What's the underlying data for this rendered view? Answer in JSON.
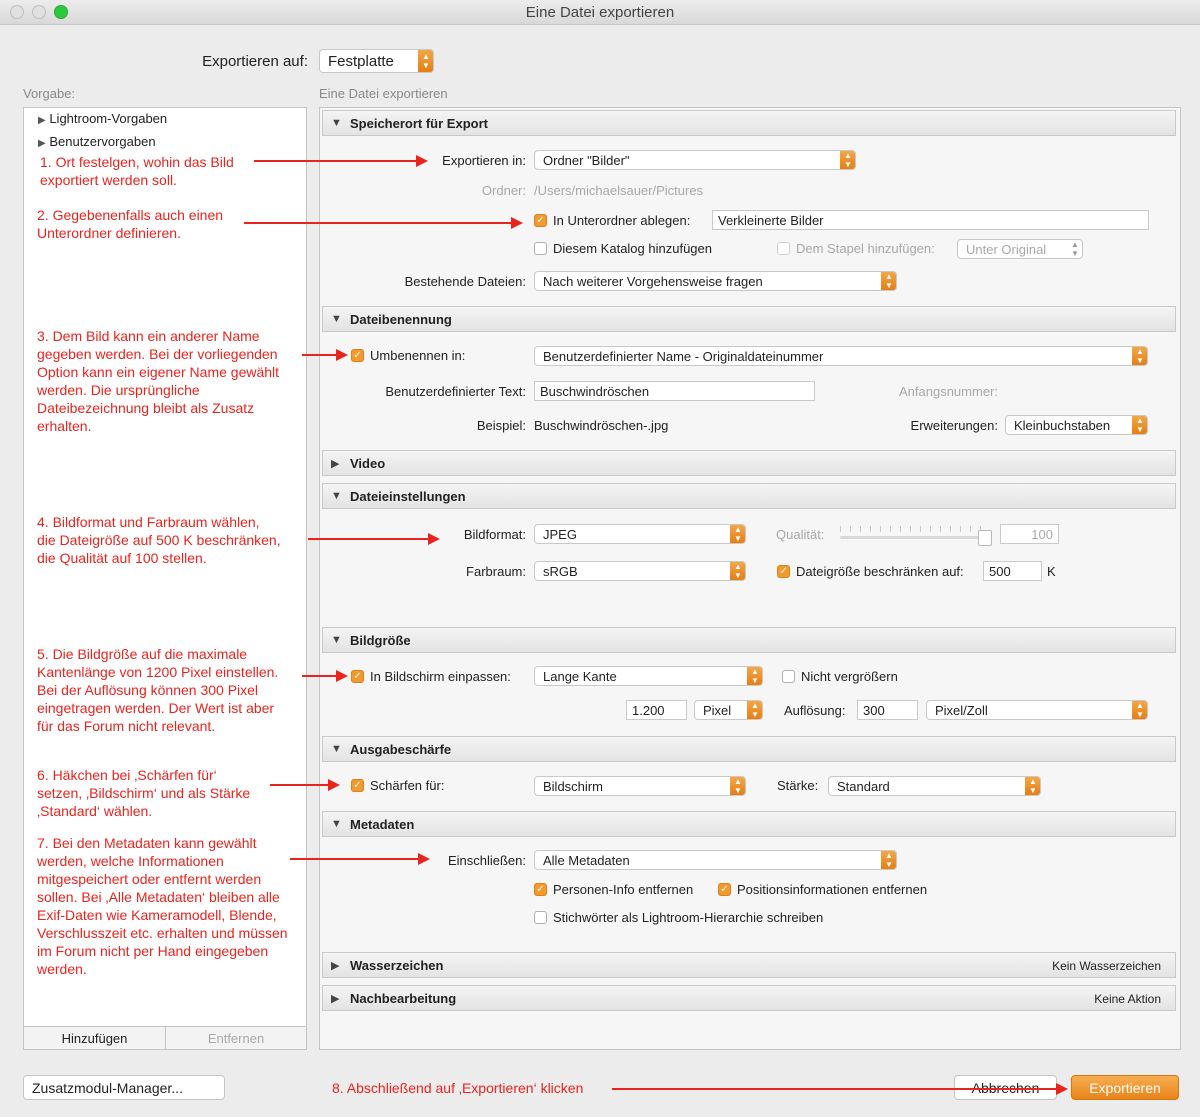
{
  "window": {
    "title": "Eine Datei exportieren"
  },
  "export_to": {
    "label": "Exportieren auf:",
    "value": "Festplatte"
  },
  "presets": {
    "label": "Vorgabe:",
    "items": [
      {
        "label": "Lightroom-Vorgaben"
      },
      {
        "label": "Benutzervorgaben"
      }
    ],
    "add_label": "Hinzufügen",
    "remove_label": "Entfernen"
  },
  "right_pane_label": "Eine Datei exportieren",
  "sections": {
    "location": {
      "title": "Speicherort für Export",
      "export_in_label": "Exportieren in:",
      "export_in_value": "Ordner \"Bilder\"",
      "folder_label": "Ordner:",
      "folder_value": "/Users/michaelsauer/Pictures",
      "subfolder_label": "In Unterordner ablegen:",
      "subfolder_value": "Verkleinerte Bilder",
      "catalog_label": "Diesem Katalog hinzufügen",
      "stack_label": "Dem Stapel hinzufügen:",
      "stack_value": "Unter Original",
      "existing_label": "Bestehende Dateien:",
      "existing_value": "Nach weiterer Vorgehensweise fragen"
    },
    "naming": {
      "title": "Dateibenennung",
      "rename_label": "Umbenennen in:",
      "rename_value": "Benutzerdefinierter Name - Originaldateinummer",
      "custom_text_label": "Benutzerdefinierter Text:",
      "custom_text_value": "Buschwindröschen",
      "start_number_label": "Anfangsnummer:",
      "example_label": "Beispiel:",
      "example_value": "Buschwindröschen-.jpg",
      "extensions_label": "Erweiterungen:",
      "extensions_value": "Kleinbuchstaben"
    },
    "video": {
      "title": "Video"
    },
    "file_settings": {
      "title": "Dateieinstellungen",
      "format_label": "Bildformat:",
      "format_value": "JPEG",
      "quality_label": "Qualität:",
      "quality_value": "100",
      "colorspace_label": "Farbraum:",
      "colorspace_value": "sRGB",
      "limit_label": "Dateigröße beschränken auf:",
      "limit_value": "500",
      "limit_unit": "K"
    },
    "image_size": {
      "title": "Bildgröße",
      "fit_label": "In Bildschirm einpassen:",
      "fit_value": "Lange Kante",
      "no_enlarge_label": "Nicht vergrößern",
      "size_value": "1.200",
      "size_unit": "Pixel",
      "resolution_label": "Auflösung:",
      "resolution_value": "300",
      "resolution_unit": "Pixel/Zoll"
    },
    "sharpening": {
      "title": "Ausgabeschärfe",
      "sharpen_label": "Schärfen für:",
      "sharpen_value": "Bildschirm",
      "amount_label": "Stärke:",
      "amount_value": "Standard"
    },
    "metadata": {
      "title": "Metadaten",
      "include_label": "Einschließen:",
      "include_value": "Alle Metadaten",
      "person_label": "Personen-Info entfernen",
      "location_label": "Positionsinformationen entfernen",
      "keywords_label": "Stichwörter als Lightroom-Hierarchie schreiben"
    },
    "watermark": {
      "title": "Wasserzeichen",
      "value": "Kein Wasserzeichen"
    },
    "postprocess": {
      "title": "Nachbearbeitung",
      "value": "Keine Aktion"
    }
  },
  "footer": {
    "plugin_manager_label": "Zusatzmodul-Manager...",
    "cancel_label": "Abbrechen",
    "export_label": "Exportieren"
  },
  "annotations": [
    "1. Ort festelgen, wohin das Bild\nexportiert werden soll.",
    "2. Gegebenenfalls auch einen\nUnterordner definieren.",
    "3. Dem Bild kann ein anderer Name\ngegeben werden. Bei der vorliegenden\nOption kann ein eigener Name gewählt\nwerden. Die ursprüngliche\nDateibezeichnung bleibt als Zusatz\nerhalten.",
    "4. Bildformat und Farbraum wählen,\ndie Dateigröße auf 500 K beschränken,\ndie Qualität auf 100 stellen.",
    "5. Die Bildgröße auf die maximale\nKantenlänge von 1200 Pixel einstellen.\nBei der Auflösung können 300 Pixel\neingetragen werden. Der Wert ist aber\nfür das Forum nicht relevant.",
    "6. Häkchen bei ‚Schärfen für‘\nsetzen, ‚Bildschirm‘ und als Stärke\n‚Standard‘ wählen.",
    "7. Bei den Metadaten kann gewählt\nwerden, welche Informationen\nmitgespeichert oder entfernt werden\nsollen. Bei ‚Alle Metadaten‘ bleiben alle\nExif-Daten wie Kameramodell, Blende,\nVerschlusszeit etc. erhalten und müssen\nim Forum nicht per Hand eingegeben\nwerden.",
    "8. Abschließend auf ‚Exportieren‘ klicken"
  ],
  "colors": {
    "accent": "#f29a2e",
    "annotation": "#e8241f"
  },
  "icons": {
    "popup": "orange-stepper-icon",
    "disclosure": "disclosure-triangle-icon",
    "check": "checkmark-icon"
  }
}
